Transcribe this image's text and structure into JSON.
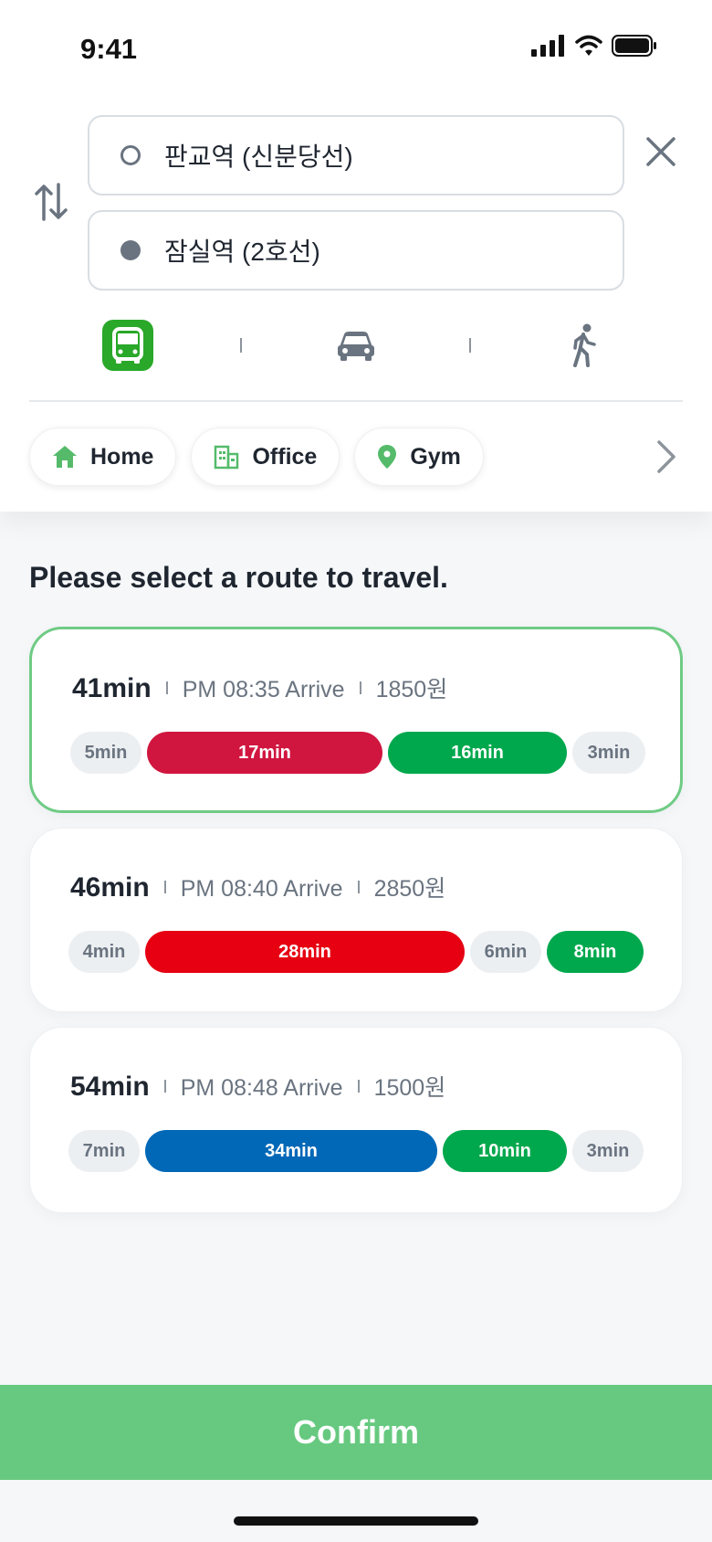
{
  "status_bar": {
    "time": "9:41"
  },
  "route_input": {
    "origin": "판교역 (신분당선)",
    "destination": "잠실역 (2호선)"
  },
  "modes": {
    "items": [
      "bus",
      "car",
      "walk"
    ],
    "selected": "bus",
    "accent": "#29a829"
  },
  "places": [
    {
      "label": "Home",
      "icon": "home-icon"
    },
    {
      "label": "Office",
      "icon": "building-icon"
    },
    {
      "label": "Gym",
      "icon": "pin-icon"
    }
  ],
  "heading": "Please select a route to travel.",
  "routes": [
    {
      "duration": "41min",
      "arrive": "PM 08:35 Arrive",
      "fare": "1850원",
      "selected": true,
      "segments": [
        {
          "label": "5min",
          "kind": "walk"
        },
        {
          "label": "17min",
          "kind": "ride",
          "color": "#d0163f"
        },
        {
          "label": "16min",
          "kind": "ride",
          "color": "#00a84d"
        },
        {
          "label": "3min",
          "kind": "walk"
        }
      ]
    },
    {
      "duration": "46min",
      "arrive": "PM 08:40 Arrive",
      "fare": "2850원",
      "selected": false,
      "segments": [
        {
          "label": "4min",
          "kind": "walk"
        },
        {
          "label": "28min",
          "kind": "ride",
          "color": "#e60012"
        },
        {
          "label": "6min",
          "kind": "walk"
        },
        {
          "label": "8min",
          "kind": "ride",
          "color": "#00a84d"
        }
      ]
    },
    {
      "duration": "54min",
      "arrive": "PM 08:48 Arrive",
      "fare": "1500원",
      "selected": false,
      "segments": [
        {
          "label": "7min",
          "kind": "walk"
        },
        {
          "label": "34min",
          "kind": "ride",
          "color": "#0068b7"
        },
        {
          "label": "10min",
          "kind": "ride",
          "color": "#00a84d"
        },
        {
          "label": "3min",
          "kind": "walk"
        }
      ]
    }
  ],
  "confirm_label": "Confirm",
  "colors": {
    "selected_border": "#6fcb85",
    "confirm": "#66c97f",
    "place_icon": "#55bb6b"
  }
}
